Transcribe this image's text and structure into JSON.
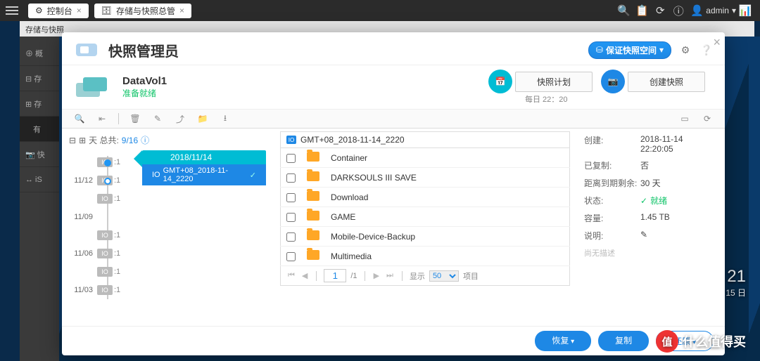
{
  "topbar": {
    "tabs": [
      {
        "icon": "gear-icon",
        "label": "控制台"
      },
      {
        "icon": "snapshot-icon",
        "label": "存储与快照总管"
      }
    ],
    "user": "admin"
  },
  "subheader": "存储与快照",
  "modal": {
    "title": "快照管理员",
    "pill": "保证快照空间",
    "volume": {
      "name": "DataVol1",
      "status": "准备就绪"
    },
    "buttons": {
      "plan": "快照计划",
      "create": "创建快照",
      "schedule": "每日 22：20"
    },
    "snapshot_count_label": "天 总共:",
    "snapshot_count": "9/16",
    "selected_date": "2018/11/14",
    "selected_name": "GMT+08_2018-11-14_2220",
    "timeline": [
      {
        "date": "",
        "badge": "IO",
        "label": ":1",
        "dot": true,
        "sel": true
      },
      {
        "date": "11/12",
        "badge": "IO",
        "label": ":1",
        "dot": true
      },
      {
        "date": "",
        "badge": "IO",
        "label": ":1"
      },
      {
        "date": "11/09",
        "badge": "",
        "label": ""
      },
      {
        "date": "",
        "badge": "IO",
        "label": ":1"
      },
      {
        "date": "11/06",
        "badge": "IO",
        "label": ":1"
      },
      {
        "date": "",
        "badge": "IO",
        "label": ":1"
      },
      {
        "date": "11/03",
        "badge": "IO",
        "label": ":1"
      }
    ],
    "breadcrumb": "GMT+08_2018-11-14_2220",
    "files": [
      "Container",
      "DARKSOULS III SAVE",
      "Download",
      "GAME",
      "Mobile-Device-Backup",
      "Multimedia"
    ],
    "pager": {
      "page": "1",
      "total": "/1",
      "show_label": "显示",
      "per_page": "50",
      "items_label": "项目"
    },
    "detail": {
      "created_k": "创建:",
      "created_v": "2018-11-14 22:20:05",
      "copied_k": "已复制:",
      "copied_v": "否",
      "expire_k": "距离到期剩余:",
      "expire_v": "30 天",
      "state_k": "状态:",
      "state_v": "就绪",
      "size_k": "容量:",
      "size_v": "1.45 TB",
      "desc_k": "说明:",
      "desc_placeholder": "尚无描述"
    },
    "footer": {
      "restore": "恢复",
      "copy": "复制",
      "revert": "还原"
    }
  },
  "watermark": "什么值得买",
  "clock": {
    "time": "21",
    "date": "15 日"
  }
}
